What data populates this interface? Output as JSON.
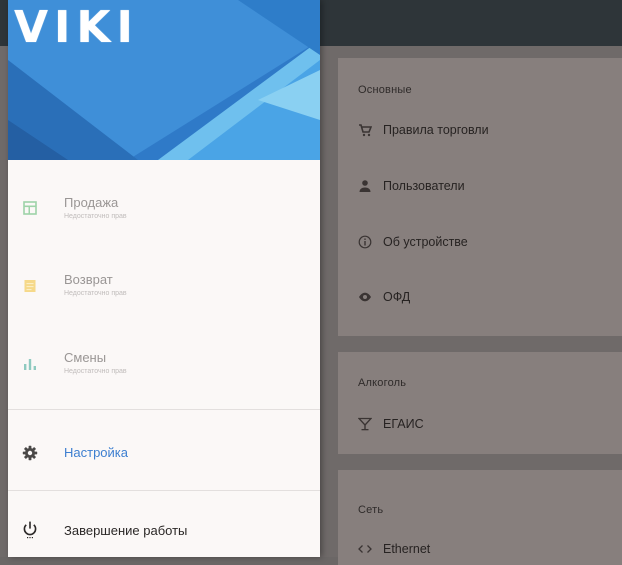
{
  "app": {
    "logo": "VIKI"
  },
  "drawer": {
    "items": [
      {
        "title": "Продажа",
        "subtitle": "Недостаточно прав",
        "icon": "sale-table-icon"
      },
      {
        "title": "Возврат",
        "subtitle": "Недостаточно прав",
        "icon": "return-note-icon"
      },
      {
        "title": "Смены",
        "subtitle": "Недостаточно прав",
        "icon": "shifts-chart-icon"
      }
    ],
    "settings": {
      "title": "Настройка",
      "icon": "gear-icon"
    },
    "exit": {
      "title": "Завершение работы",
      "icon": "power-icon"
    }
  },
  "settings_screen": {
    "sections": [
      {
        "title": "Основные",
        "rows": [
          {
            "label": "Правила торговли",
            "icon": "cart-icon"
          },
          {
            "label": "Пользователи",
            "icon": "user-icon"
          },
          {
            "label": "Об устройстве",
            "icon": "info-icon"
          },
          {
            "label": "ОФД",
            "icon": "eye-icon"
          }
        ]
      },
      {
        "title": "Алкоголь",
        "rows": [
          {
            "label": "ЕГАИС",
            "icon": "glass-icon"
          }
        ]
      },
      {
        "title": "Сеть",
        "rows": [
          {
            "label": "Ethernet",
            "icon": "ethernet-icon"
          }
        ]
      }
    ]
  },
  "colors": {
    "accent": "#3d7fd0",
    "header_blue": "#3f8fd8",
    "appbar": "#2e3539",
    "scrim": "#6f6a69"
  }
}
